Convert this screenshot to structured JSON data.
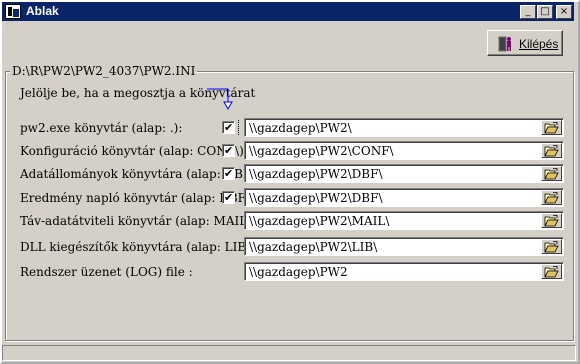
{
  "window": {
    "title": "Ablak"
  },
  "titlebar_buttons": {
    "minimize": "_",
    "maximize": "□",
    "close": "×"
  },
  "toolbar": {
    "exit_label": "Kilépés"
  },
  "group": {
    "title": "D:\\R\\PW2\\PW2_4037\\PW2.INI"
  },
  "hint": "Jelölje be, ha a megosztja a könyvtárat",
  "rows": [
    {
      "label": "pw2.exe könyvtár (alap: .):",
      "checked": true,
      "check_mark": "✔",
      "value": "\\\\gazdagep\\PW2\\"
    },
    {
      "label": "Konfiguráció könyvtár (alap: CONF\\):",
      "checked": true,
      "check_mark": "✔",
      "value": "\\\\gazdagep\\PW2\\CONF\\"
    },
    {
      "label": "Adatállományok könyvtára (alap: DBF\\):",
      "checked": true,
      "check_mark": "✔",
      "value": "\\\\gazdagep\\PW2\\DBF\\"
    },
    {
      "label": "Eredmény napló könyvtár (alap: DBF\\):",
      "checked": true,
      "check_mark": "✔",
      "value": "\\\\gazdagep\\PW2\\DBF\\"
    },
    {
      "label": "Táv-adatátviteli könyvtár (alap: MAIL\\):",
      "checked": false,
      "value": "\\\\gazdagep\\PW2\\MAIL\\"
    },
    {
      "label": "DLL kiegészítők könyvtára (alap: LIB\\):",
      "checked": false,
      "value": "\\\\gazdagep\\PW2\\LIB\\"
    },
    {
      "label": "Rendszer üzenet (LOG) file :",
      "checked": false,
      "value": "\\\\gazdagep\\PW2"
    }
  ],
  "icons": {
    "browse": "folder-open-icon",
    "exit": "exit-person-icon",
    "app": "app-icon"
  },
  "colors": {
    "titlebar": "#0a246a",
    "face": "#d4d0c8"
  }
}
